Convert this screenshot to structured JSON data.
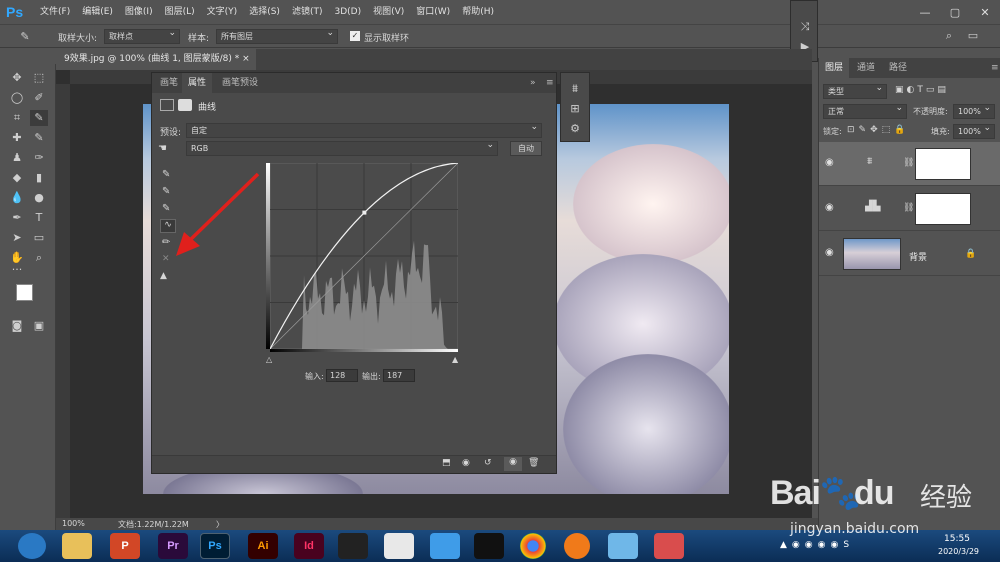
{
  "app": {
    "logo": "Ps"
  },
  "menu": [
    "文件(F)",
    "编辑(E)",
    "图像(I)",
    "图层(L)",
    "文字(Y)",
    "选择(S)",
    "滤镜(T)",
    "3D(D)",
    "视图(V)",
    "窗口(W)",
    "帮助(H)"
  ],
  "window_controls": {
    "minimize": "—",
    "maximize": "▢",
    "close": "✕"
  },
  "options_bar": {
    "sample_size_label": "取样大小:",
    "sample_size_value": "取样点",
    "sample_label": "样本:",
    "sample_value": "所有图层",
    "show_ring_label": "显示取样环",
    "show_ring_checked": "✓"
  },
  "document_tab": {
    "title": "9效果.jpg @ 100% (曲线 1, 图层蒙版/8) *",
    "close": "×"
  },
  "properties": {
    "tabs": [
      "画笔",
      "属性",
      "画笔预设"
    ],
    "active_tab": 1,
    "title": "曲线",
    "preset_label": "预设:",
    "preset_value": "自定",
    "channel_value": "RGB",
    "auto_button": "自动",
    "input_label": "输入:",
    "input_value": "128",
    "output_label": "输出:",
    "output_value": "187"
  },
  "layers_panel": {
    "tabs": [
      "图层",
      "通道",
      "路径"
    ],
    "filter_value": "类型",
    "blend_mode": "正常",
    "opacity_label": "不透明度:",
    "opacity_value": "100%",
    "lock_label": "锁定:",
    "fill_label": "填充:",
    "fill_value": "100%",
    "background_layer_name": "背景"
  },
  "status": {
    "zoom": "100%",
    "doc_info": "文档:1.22M/1.22M",
    "arrow": "〉"
  },
  "taskbar": {
    "time": "15:55",
    "date": "2020/3/29"
  },
  "watermark": {
    "brand": "Bai",
    "brand2": "du",
    "cn": "经验",
    "url": "jingyan.baidu.com"
  },
  "colors": {
    "accent": "#31a8ff",
    "annotation_arrow": "#e0201c"
  }
}
